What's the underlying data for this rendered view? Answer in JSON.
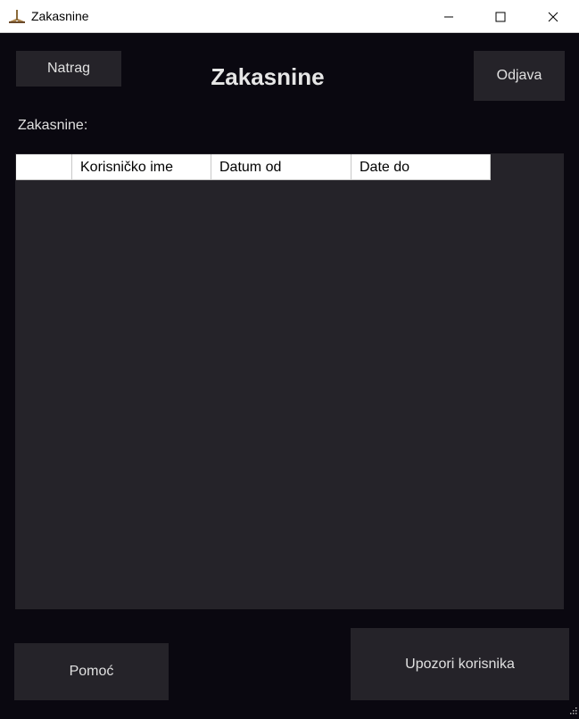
{
  "window": {
    "title": "Zakasnine",
    "icon": "app-icon",
    "controls": [
      "minimize-icon",
      "maximize-icon",
      "close-icon"
    ]
  },
  "toolbar": {
    "back_label": "Natrag",
    "logout_label": "Odjava"
  },
  "page": {
    "heading": "Zakasnine",
    "section_label": "Zakasnine:"
  },
  "grid": {
    "columns": [
      "",
      "Korisničko ime",
      "Datum od",
      "Date do"
    ],
    "rows": []
  },
  "footer": {
    "help_label": "Pomoć",
    "warn_label": "Upozori korisnika"
  },
  "colors": {
    "background": "#0a0810",
    "panel": "#252329",
    "text": "#e0e0e0"
  }
}
